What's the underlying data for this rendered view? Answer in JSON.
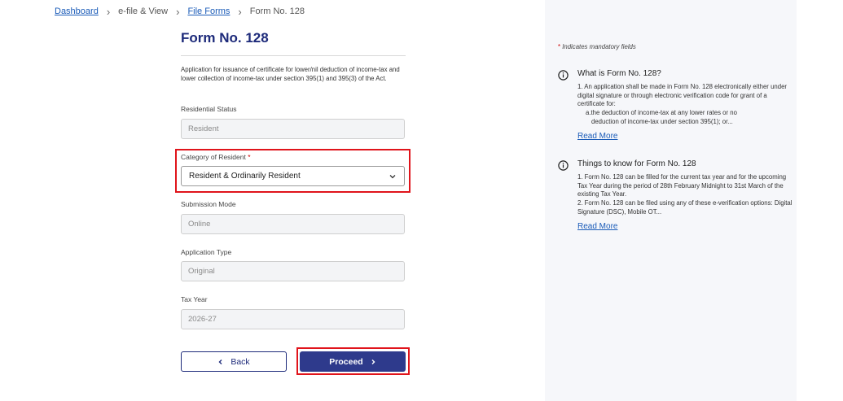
{
  "breadcrumb": {
    "dashboard": "Dashboard",
    "efile_view": "e-file & View",
    "file_forms": "File Forms",
    "current": "Form No. 128",
    "separator": "›"
  },
  "form": {
    "title": "Form No. 128",
    "description": "Application for issuance of certificate for lower/nil deduction of income-tax and lower collection of income-tax under section 395(1) and 395(3) of the Act.",
    "residential_status": {
      "label": "Residential Status",
      "value": "Resident"
    },
    "category": {
      "label": "Category of Resident",
      "required_mark": "*",
      "value": "Resident & Ordinarily Resident"
    },
    "submission_mode": {
      "label": "Submission Mode",
      "value": "Online"
    },
    "application_type": {
      "label": "Application Type",
      "value": "Original"
    },
    "tax_year": {
      "label": "Tax Year",
      "value": "2026-27"
    },
    "back_label": "Back",
    "proceed_label": "Proceed"
  },
  "side_panel": {
    "mandatory_star": "*",
    "mandatory_note": "Indicates mandatory fields",
    "what_is": {
      "title": "What is Form No. 128?",
      "line1": "1. An application shall be made in Form No. 128 electronically either under digital signature or through electronic verification code for grant of a certificate for:",
      "line2": "a.the deduction of income-tax at any lower rates or no",
      "line3": "deduction of income-tax under section 395(1); or...",
      "read_more": "Read More"
    },
    "things_to_know": {
      "title": "Things to know for Form No. 128",
      "line1": "1. Form No. 128 can be filled for the current tax year and for the upcoming Tax Year during the period of 28th February Midnight to 31st March of the existing Tax Year.",
      "line2": "2. Form No. 128 can be filed using any of these e-verification  options: Digital Signature (DSC), Mobile OT...",
      "read_more": "Read More"
    }
  },
  "colors": {
    "primary": "#2e3a8c",
    "title": "#1d2a7a",
    "link": "#1a5bb8",
    "highlight": "#e0141b",
    "panel_bg": "#f6f7fa"
  },
  "icons": {
    "info": "info-circle-icon",
    "chevron_down": "chevron-down-icon",
    "chevron_left": "chevron-left-icon",
    "chevron_right": "chevron-right-icon"
  }
}
